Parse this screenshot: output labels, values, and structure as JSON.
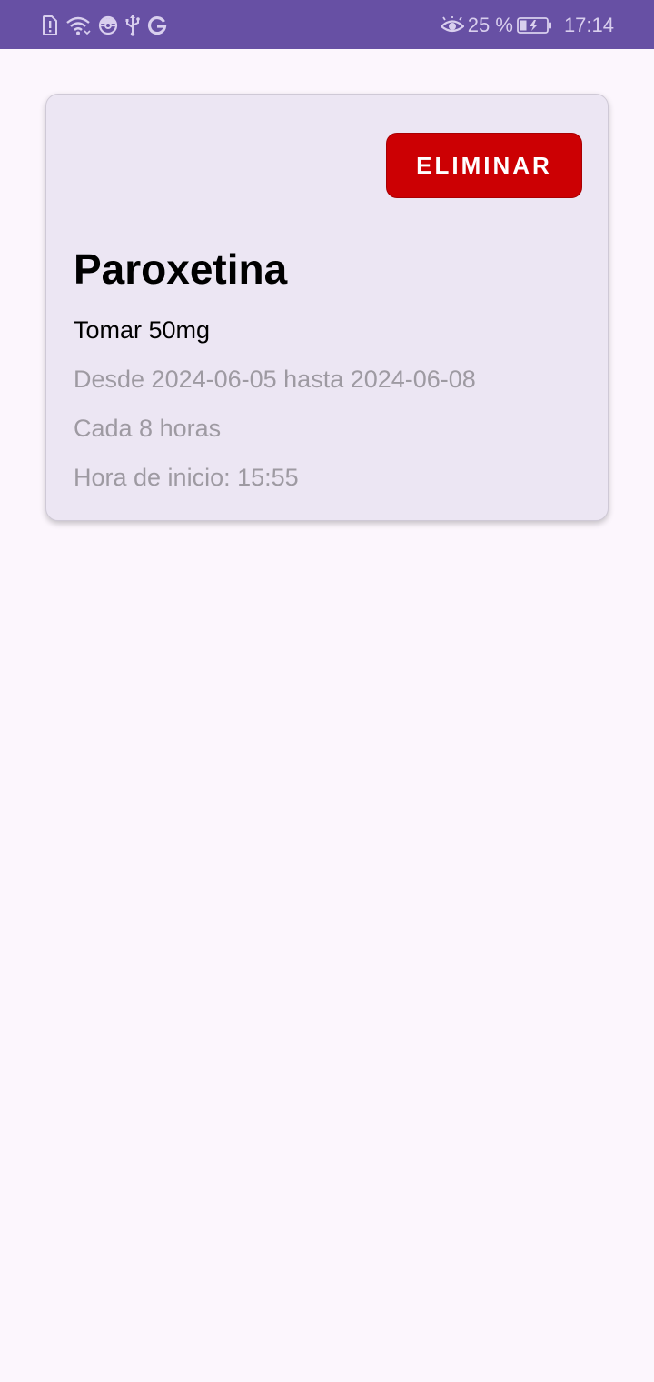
{
  "status_bar": {
    "battery": "25 %",
    "time": "17:14",
    "icons_left": [
      "sim-alert-icon",
      "wifi-icon",
      "pokeball-icon",
      "usb-icon",
      "google-icon"
    ],
    "icons_right": [
      "eye-icon",
      "battery-charging-icon"
    ],
    "background_color": "#6750A4"
  },
  "medication": {
    "delete_label": "ELIMINAR",
    "name": "Paroxetina",
    "dose": "Tomar 50mg",
    "date_range": "Desde 2024-06-05 hasta 2024-06-08",
    "frequency": "Cada 8 horas",
    "start_time": "Hora de inicio: 15:55",
    "delete_color": "#CC0003",
    "card_color": "#ECE6F3"
  }
}
